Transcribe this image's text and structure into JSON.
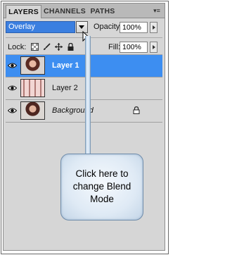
{
  "tabs": [
    {
      "label": "LAYERS",
      "active": true
    },
    {
      "label": "CHANNELS",
      "active": false
    },
    {
      "label": "PATHS",
      "active": false
    }
  ],
  "panel_menu_icon": "panel-menu-icon",
  "blend_mode": {
    "value": "Overlay",
    "highlight_color": "#3b7fe0"
  },
  "opacity": {
    "label": "Opacity:",
    "value": "100%"
  },
  "lock": {
    "label": "Lock:",
    "icons": [
      "lock-transparency-icon",
      "lock-paint-brush-icon",
      "lock-move-icon",
      "lock-all-icon"
    ]
  },
  "fill": {
    "label": "Fill:",
    "value": "100%"
  },
  "layers": [
    {
      "name": "Layer 1",
      "selected": true,
      "visible": true
    },
    {
      "name": "Layer 2",
      "selected": false,
      "visible": true
    },
    {
      "name": "Background",
      "selected": false,
      "visible": true,
      "locked": true
    }
  ],
  "selection_color": "#3d8ef1",
  "callout": {
    "text": "Click here to change Blend Mode"
  }
}
